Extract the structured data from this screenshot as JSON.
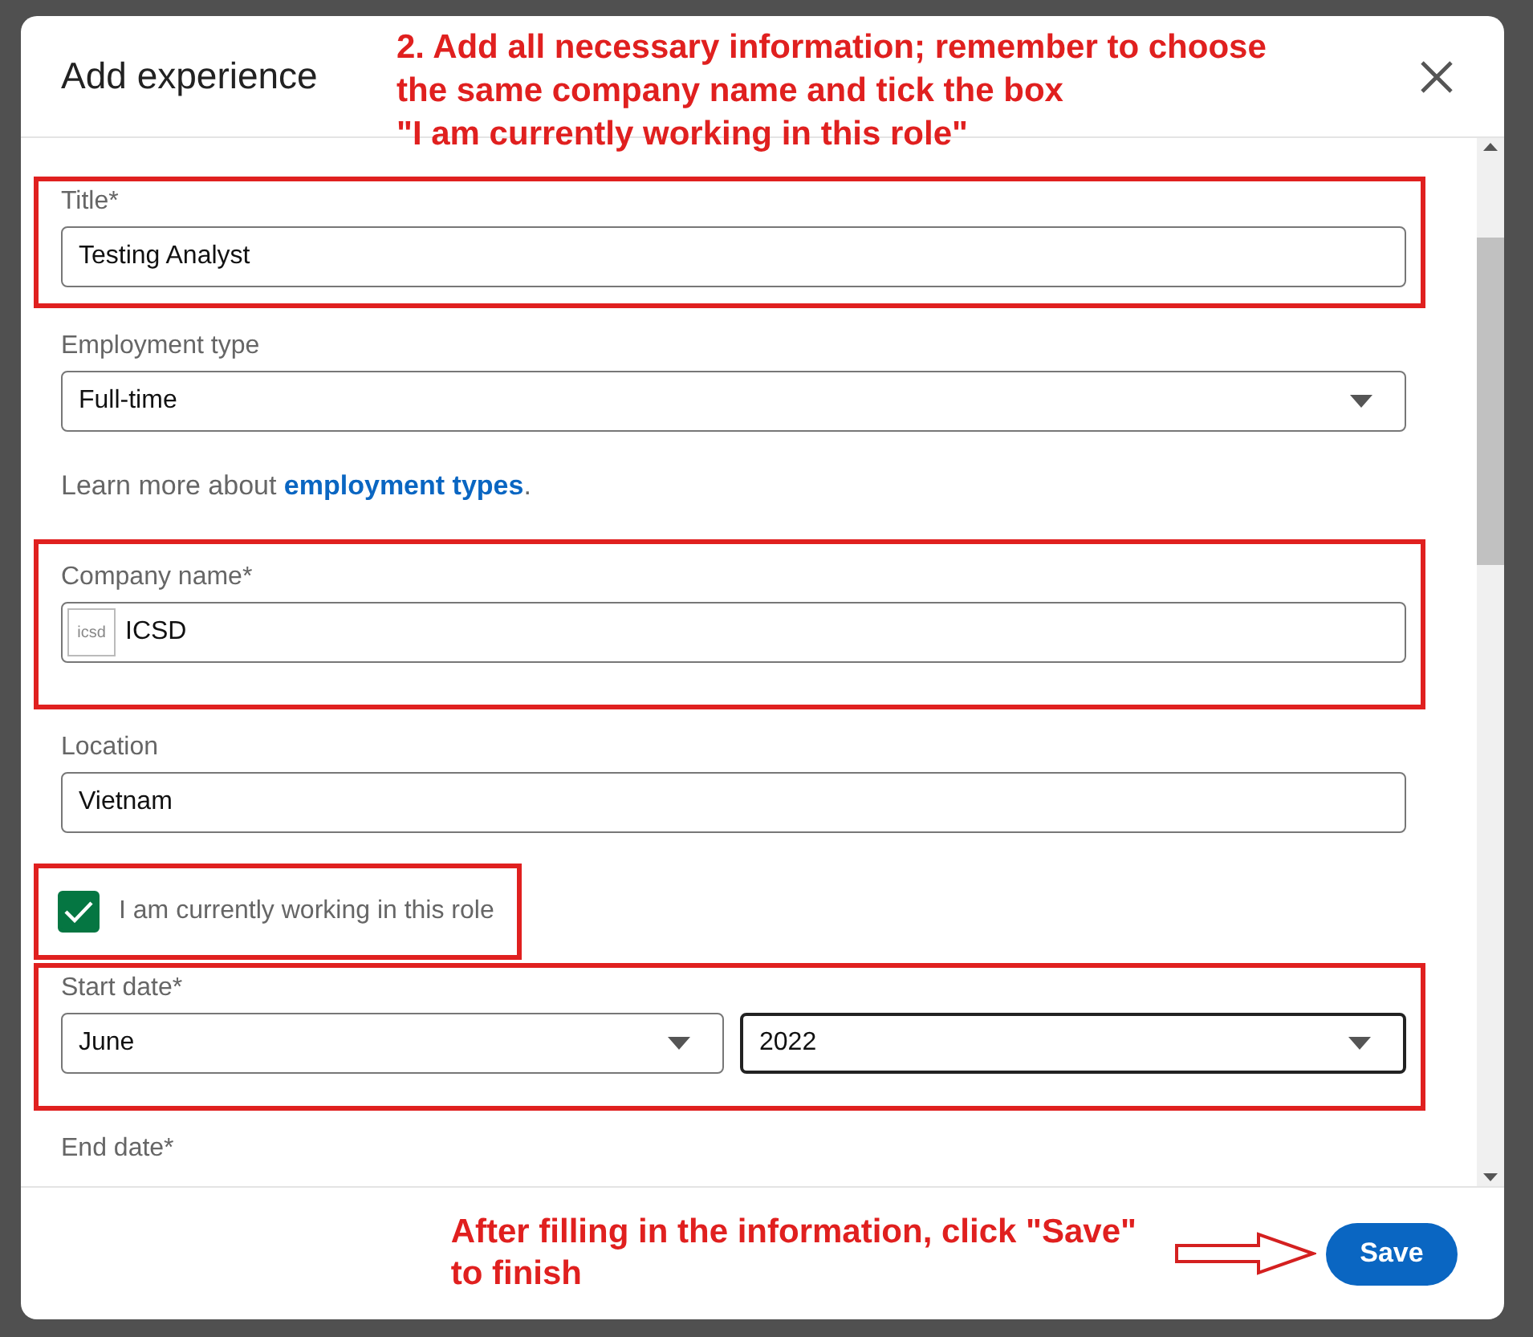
{
  "dialog": {
    "title": "Add experience"
  },
  "annotations": {
    "top": [
      "2. Add all necessary information; remember to choose",
      "the same company name and tick the box",
      "\"I am currently working in this role\""
    ],
    "bottom": [
      "After filling in the information, click \"Save\"",
      "to finish"
    ]
  },
  "form": [
    {
      "kind": "text",
      "label": "Title*",
      "value": "Testing Analyst",
      "highlighted": true
    },
    {
      "kind": "select",
      "label": "Employment type",
      "value": "Full-time",
      "highlighted": false
    },
    {
      "kind": "help",
      "text": "Learn more about ",
      "link": "employment types",
      "after": ".",
      "highlighted": false
    },
    {
      "kind": "company",
      "label": "Company name*",
      "value": "ICSD",
      "logo_text": "icsd",
      "highlighted": true
    },
    {
      "kind": "text",
      "label": "Location",
      "value": "Vietnam",
      "highlighted": false
    },
    {
      "kind": "checkbox",
      "label": "I am currently working in this role",
      "checked": true,
      "highlighted": true
    },
    {
      "kind": "date",
      "label": "Start date*",
      "month": "June",
      "year": "2022",
      "highlighted": true
    },
    {
      "kind": "label",
      "label": "End date*",
      "highlighted": false
    }
  ],
  "footer": {
    "save": "Save"
  }
}
